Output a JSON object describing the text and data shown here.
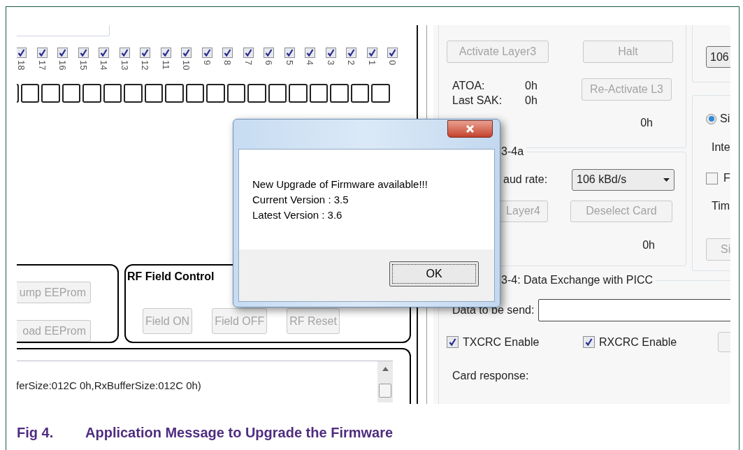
{
  "left_panel": {
    "bits": [
      {
        "label": "18",
        "checked": true
      },
      {
        "label": "17",
        "checked": true
      },
      {
        "label": "16",
        "checked": true
      },
      {
        "label": "15",
        "checked": true
      },
      {
        "label": "14",
        "checked": true
      },
      {
        "label": "13",
        "checked": true
      },
      {
        "label": "12",
        "checked": true
      },
      {
        "label": "11",
        "checked": true
      },
      {
        "label": "10",
        "checked": true
      },
      {
        "label": "9",
        "checked": true
      },
      {
        "label": "8",
        "checked": true
      },
      {
        "label": "7",
        "checked": true
      },
      {
        "label": "6",
        "checked": true
      },
      {
        "label": "5",
        "checked": true
      },
      {
        "label": "4",
        "checked": true
      },
      {
        "label": "3",
        "checked": true
      },
      {
        "label": "2",
        "checked": true
      },
      {
        "label": "1",
        "checked": true
      },
      {
        "label": "0",
        "checked": true
      }
    ],
    "eeprom_group": {
      "buttons": [
        {
          "label": "ump EEProm",
          "disabled": true
        },
        {
          "label": "oad EEProm",
          "disabled": true
        }
      ]
    },
    "rf_field_control": {
      "title": "RF Field Control",
      "buttons": [
        {
          "label": "Field ON",
          "disabled": true
        },
        {
          "label": "Field OFF",
          "disabled": true
        },
        {
          "label": "RF Reset",
          "disabled": true
        }
      ]
    },
    "log": {
      "lines": [
        "ferSize:012C 0h,RxBufferSize:012C 0h)"
      ]
    }
  },
  "right_panel": {
    "layer3": {
      "buttons": [
        {
          "label": "Activate Layer3",
          "disabled": true
        },
        {
          "label": "Halt",
          "disabled": true
        },
        {
          "label": "Re-Activate L3",
          "disabled": true
        }
      ],
      "fields": [
        {
          "label": "ATOA:",
          "value": "0h"
        },
        {
          "label": "Last SAK:",
          "value": "0h"
        }
      ],
      "uid_value": "0h"
    },
    "layer4": {
      "title": "3-4a",
      "baud_label": "aud rate:",
      "baud_value": "106 kBd/s",
      "buttons": [
        {
          "label": "Layer4",
          "disabled": true
        },
        {
          "label": "Deselect Card",
          "disabled": true
        }
      ],
      "value": "0h"
    },
    "data_exchange": {
      "title": "3-4: Data Exchange with PICC",
      "data_label": "Data to be send:",
      "checkboxes": [
        {
          "label": "TXCRC Enable",
          "checked": true
        },
        {
          "label": "RXCRC Enable",
          "checked": true
        }
      ],
      "response_label": "Card response:"
    },
    "side": {
      "rate_value": "106",
      "radio": {
        "label": "Si",
        "selected": true
      },
      "label_1": "Inte",
      "checkbox": {
        "label": "F",
        "checked": false
      },
      "label_2": "Tim",
      "button": {
        "label": "Si",
        "disabled": true
      }
    }
  },
  "dialog": {
    "lines": [
      "New Upgrade of Firmware available!!!",
      "Current Version : 3.5",
      "Latest Version : 3.6"
    ],
    "button": "OK"
  },
  "caption": {
    "number": "Fig 4.",
    "text": "Application Message to Upgrade the Firmware"
  }
}
